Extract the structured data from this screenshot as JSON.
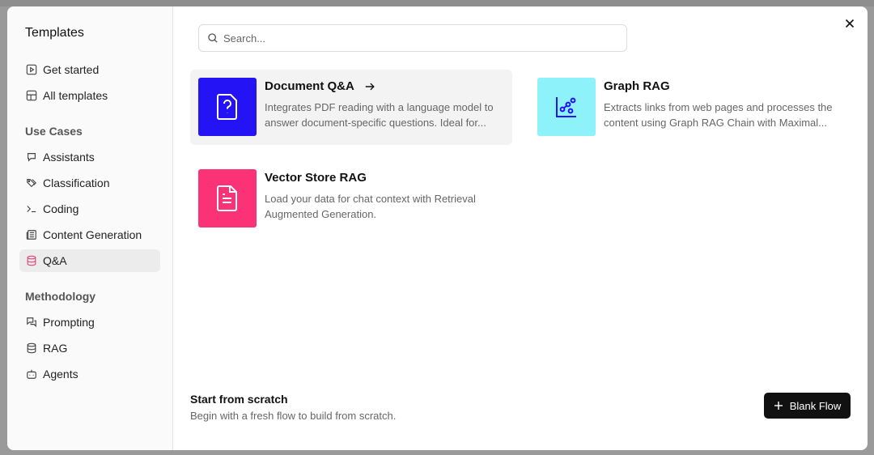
{
  "sidebar": {
    "title": "Templates",
    "top_items": [
      {
        "label": "Get started",
        "icon": "play-square-icon"
      },
      {
        "label": "All templates",
        "icon": "layout-grid-icon"
      }
    ],
    "use_cases": {
      "title": "Use Cases",
      "items": [
        {
          "label": "Assistants",
          "icon": "chat-bot-icon"
        },
        {
          "label": "Classification",
          "icon": "tags-icon"
        },
        {
          "label": "Coding",
          "icon": "terminal-icon"
        },
        {
          "label": "Content Generation",
          "icon": "newspaper-icon"
        },
        {
          "label": "Q&A",
          "icon": "database-icon",
          "active": true
        }
      ]
    },
    "methodology": {
      "title": "Methodology",
      "items": [
        {
          "label": "Prompting",
          "icon": "messages-icon"
        },
        {
          "label": "RAG",
          "icon": "database-icon"
        },
        {
          "label": "Agents",
          "icon": "bot-icon"
        }
      ]
    }
  },
  "search": {
    "placeholder": "Search..."
  },
  "cards": [
    {
      "title": "Document Q&A",
      "description": "Integrates PDF reading with a language model to answer document-specific questions. Ideal for...",
      "color": "#2313f5",
      "icon": "file-question-icon"
    },
    {
      "title": "Graph RAG",
      "description": "Extracts links from web pages and processes the content using Graph RAG Chain with Maximal...",
      "color": "#8ef2fb",
      "icon": "chart-scatter-icon"
    },
    {
      "title": "Vector Store RAG",
      "description": "Load your data for chat context with Retrieval Augmented Generation.",
      "color": "#fb3276",
      "icon": "file-text-icon"
    }
  ],
  "scratch": {
    "title": "Start from scratch",
    "description": "Begin with a fresh flow to build from scratch.",
    "button_label": "Blank Flow"
  },
  "colors": {
    "accent_active_icon": "#e0457b",
    "button_bg": "#111111"
  }
}
